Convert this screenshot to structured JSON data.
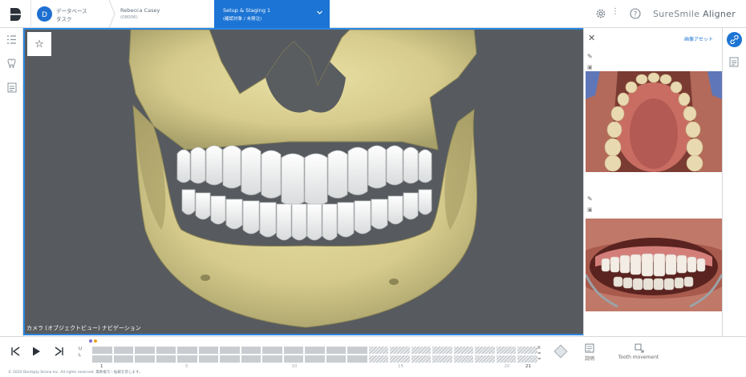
{
  "app": {
    "product_name": "SureSmile",
    "product_suffix": "Aligner",
    "accent_color": "#1c74d4"
  },
  "breadcrumb": {
    "database": {
      "line1": "データベース",
      "line2": "タスク"
    },
    "patient": {
      "name": "Rebecca Casey",
      "id": "(08006)"
    },
    "setup": {
      "title": "Setup & Staging 1",
      "subtitle": "(確認対象 / 未発注)"
    }
  },
  "viewport": {
    "caption": "カメラ (オブジェクトビュー) ナビゲーション"
  },
  "right_panel": {
    "title": "画像アセット"
  },
  "timeline": {
    "upper_label": "U",
    "lower_label": "L",
    "stage_labels": [
      "1",
      "5",
      "10",
      "15",
      "20",
      "21"
    ],
    "upper_marker_colors": [
      "#7a6ad8",
      "#f0a020"
    ],
    "range_label_top": "X",
    "range_label_mid": "=",
    "range_label_bot": "=",
    "tools": [
      {
        "label": "説明"
      },
      {
        "label": "Tooth movement"
      }
    ],
    "copyright": "© 2020 Dentsply Sirona Inc. All rights reserved. 無断複写・転載を禁じます。"
  }
}
